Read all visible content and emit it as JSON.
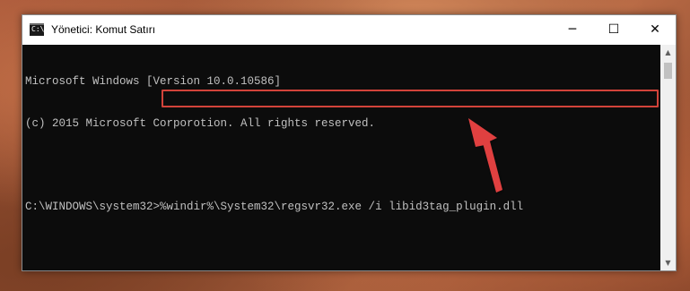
{
  "window": {
    "title": "Yönetici: Komut Satırı",
    "icon": "cmd-icon",
    "icon_glyph": "C:\\",
    "controls": {
      "minimize": "─",
      "maximize": "☐",
      "close": "✕"
    }
  },
  "console": {
    "lines": [
      "Microsoft Windows [Version 10.0.10586]",
      "(c) 2015 Microsoft Corporotion. All rights reserved.",
      "",
      "C:\\WINDOWS\\system32>%windir%\\System32\\regsvr32.exe /i libid3tag_plugin.dll"
    ]
  },
  "scrollbar": {
    "up": "▲",
    "down": "▼"
  },
  "annotation": {
    "highlight_color": "#d2433a",
    "arrow_color": "#e04040"
  }
}
